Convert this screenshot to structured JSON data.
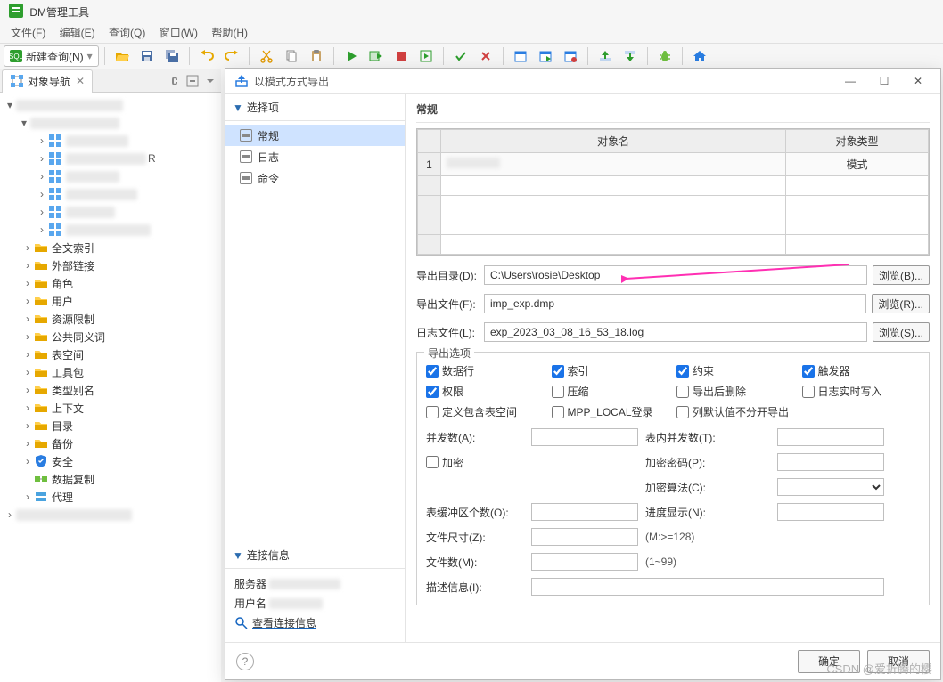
{
  "app": {
    "title": "DM管理工具"
  },
  "menu": [
    "文件(F)",
    "编辑(E)",
    "查询(Q)",
    "窗口(W)",
    "帮助(H)"
  ],
  "toolbar": {
    "new_query": "新建查询(N)"
  },
  "nav": {
    "tab_title": "对象导航",
    "items": [
      "全文索引",
      "外部链接",
      "角色",
      "用户",
      "资源限制",
      "公共同义词",
      "表空间",
      "工具包",
      "类型别名",
      "上下文",
      "目录",
      "备份",
      "安全",
      "数据复制",
      "代理"
    ]
  },
  "dialog": {
    "title": "以模式方式导出",
    "left": {
      "section": "选择项",
      "opts": [
        "常规",
        "日志",
        "命令"
      ],
      "conn_section": "连接信息",
      "conn": {
        "server_label": "服务器",
        "user_label": "用户名",
        "view_link": "查看连接信息"
      }
    },
    "right": {
      "head": "常规",
      "table": {
        "col1": "对象名",
        "col2": "对象类型",
        "row1_type": "模式"
      },
      "export_dir_label": "导出目录(D):",
      "export_dir_value": "C:\\Users\\rosie\\Desktop",
      "browse_b": "浏览(B)...",
      "export_file_label": "导出文件(F):",
      "export_file_value": "imp_exp.dmp",
      "browse_r": "浏览(R)...",
      "log_file_label": "日志文件(L):",
      "log_file_value": "exp_2023_03_08_16_53_18.log",
      "browse_s": "浏览(S)...",
      "options_legend": "导出选项",
      "cb": {
        "data_rows": "数据行",
        "index": "索引",
        "constraint": "约束",
        "trigger": "触发器",
        "privilege": "权限",
        "compress": "压缩",
        "drop_after": "导出后删除",
        "log_realtime": "日志实时写入",
        "include_ts": "定义包含表空间",
        "mpp_local": "MPP_LOCAL登录",
        "default_skip": "列默认值不分开导出"
      },
      "labels": {
        "concurrency": "并发数(A):",
        "inner_concurrency": "表内并发数(T):",
        "encrypt": "加密",
        "enc_pwd": "加密密码(P):",
        "enc_alg": "加密算法(C):",
        "buffer": "表缓冲区个数(O):",
        "progress": "进度显示(N):",
        "file_size": "文件尺寸(Z):",
        "file_size_hint": "(M:>=128)",
        "file_count": "文件数(M):",
        "file_count_hint": "(1~99)",
        "desc": "描述信息(I):"
      }
    },
    "buttons": {
      "ok": "确定",
      "cancel": "取消"
    }
  },
  "watermark": "CSDN @爱折腾的樱"
}
